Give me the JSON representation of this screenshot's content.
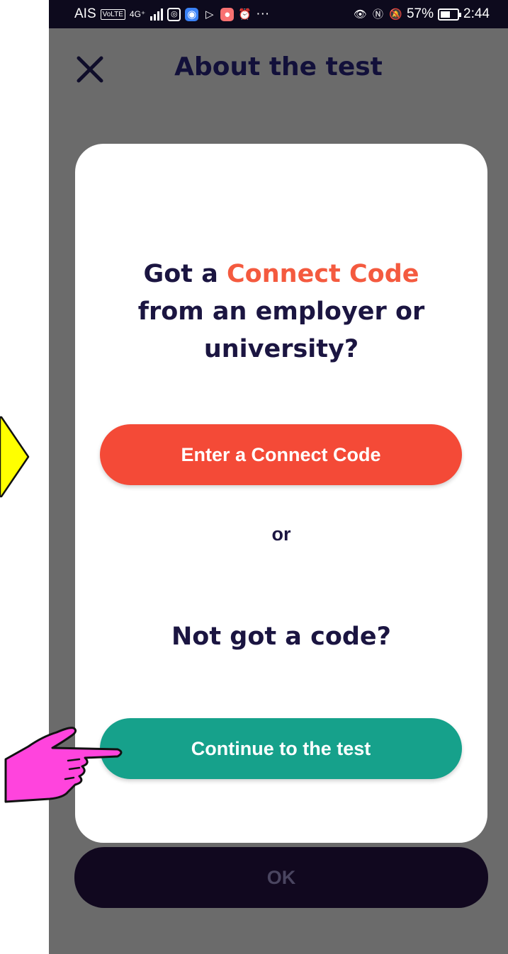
{
  "status_bar": {
    "carrier": "AIS",
    "volte": "VoLTE",
    "network": "4G⁺",
    "battery_percent": "57%",
    "battery_level": 0.57,
    "time": "2:44",
    "more": "···"
  },
  "header": {
    "title": "About the test"
  },
  "modal": {
    "question_lead": "Got a ",
    "question_accent": "Connect Code",
    "question_tail": "from an employer or university?",
    "connect_button": "Enter a Connect Code",
    "or_text": "or",
    "not_code": "Not got a code?",
    "continue_button": "Continue to the test"
  },
  "footer": {
    "ok_button": "OK"
  },
  "colors": {
    "accent_orange": "#f44a37",
    "teal": "#16a18b",
    "navy_text": "#1b1541",
    "overlay_gray": "#6b6b6b",
    "pointer_pink": "#ff44dd",
    "pointer_yellow": "#ffff00"
  }
}
